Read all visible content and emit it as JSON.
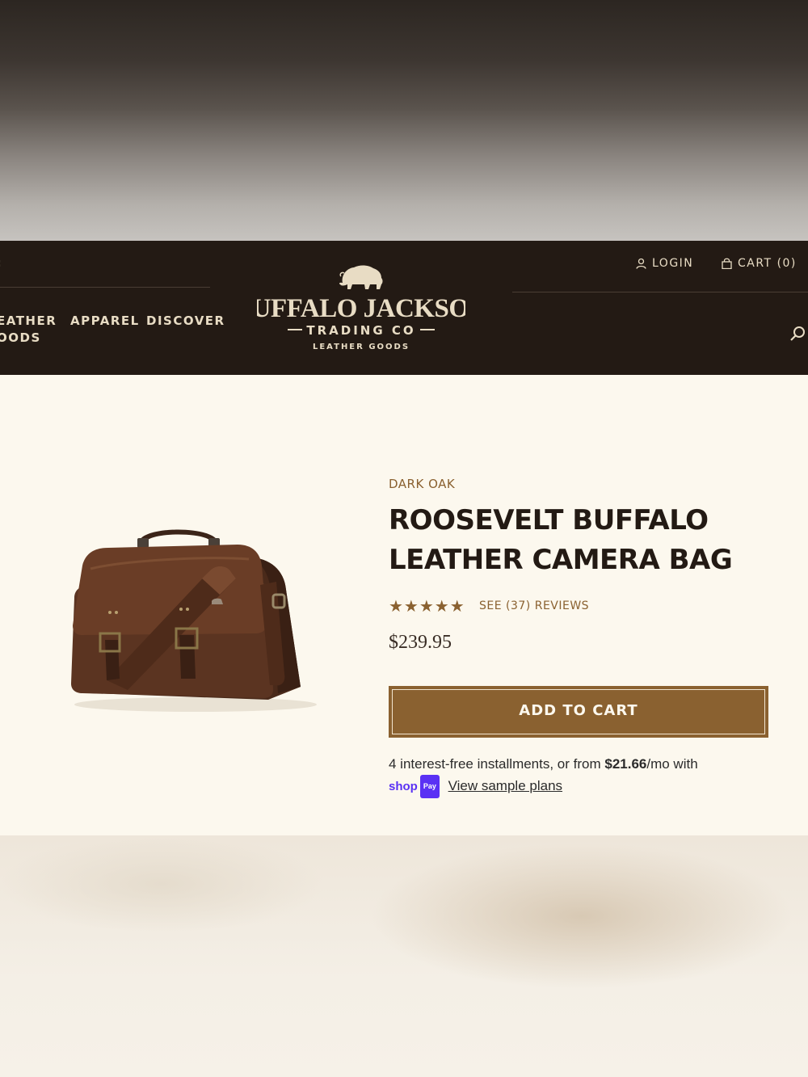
{
  "header": {
    "nav": [
      {
        "label": "EATHER\nOODS"
      },
      {
        "label": "APPAREL"
      },
      {
        "label": "DISCOVER"
      }
    ],
    "logo": {
      "line1": "BUFFALO JACKSON",
      "line2": "TRADING CO",
      "line3": "LEATHER GOODS"
    },
    "login_label": "LOGIN",
    "cart_label": "CART (0)"
  },
  "product": {
    "variant": "DARK OAK",
    "title": "ROOSEVELT BUFFALO LEATHER CAMERA BAG",
    "stars": "★★★★★",
    "rating": 5,
    "reviews_link": "SEE (37) REVIEWS",
    "price": "$239.95",
    "add_to_cart": "ADD TO CART",
    "installments_prefix": "4 interest-free installments, or from ",
    "installments_amount": "$21.66",
    "installments_suffix": "/mo with",
    "shoppay_word": "shop",
    "shoppay_badge": "Pay",
    "sample_plans": "View sample plans"
  },
  "colors": {
    "header_bg": "#231a14",
    "accent": "#8a6130",
    "page_bg": "#fcf8ee",
    "shoppay": "#5a31f4"
  }
}
